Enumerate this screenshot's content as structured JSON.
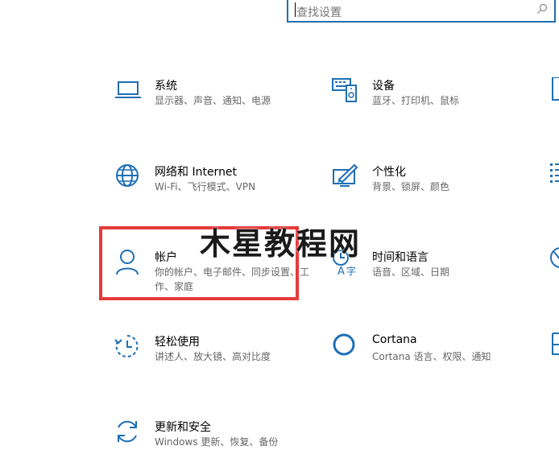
{
  "search": {
    "placeholder": "查找设置"
  },
  "tiles": [
    {
      "title": "系统",
      "desc": "显示器、声音、通知、电源"
    },
    {
      "title": "设备",
      "desc": "蓝牙、打印机、鼠标"
    },
    {
      "title": "网络和 Internet",
      "desc": "Wi-Fi、飞行模式、VPN"
    },
    {
      "title": "个性化",
      "desc": "背景、锁屏、颜色"
    },
    {
      "title": "帐户",
      "desc": "你的帐户、电子邮件、同步设置、工作、家庭"
    },
    {
      "title": "时间和语言",
      "desc": "语音、区域、日期"
    },
    {
      "title": "轻松使用",
      "desc": "讲述人、放大镜、高对比度"
    },
    {
      "title": "Cortana",
      "desc": "Cortana 语言、权限、通知"
    },
    {
      "title": "更新和安全",
      "desc": "Windows 更新、恢复、备份"
    }
  ],
  "watermark": "木星教程网",
  "colors": {
    "accent": "#1f6fb5",
    "highlight": "#e53b3b"
  },
  "icons": [
    "laptop-icon",
    "keyboard-device-icon",
    "globe-icon",
    "paint-brush-icon",
    "person-icon",
    "time-language-icon",
    "ease-of-access-icon",
    "cortana-circle-icon",
    "sync-icon"
  ]
}
